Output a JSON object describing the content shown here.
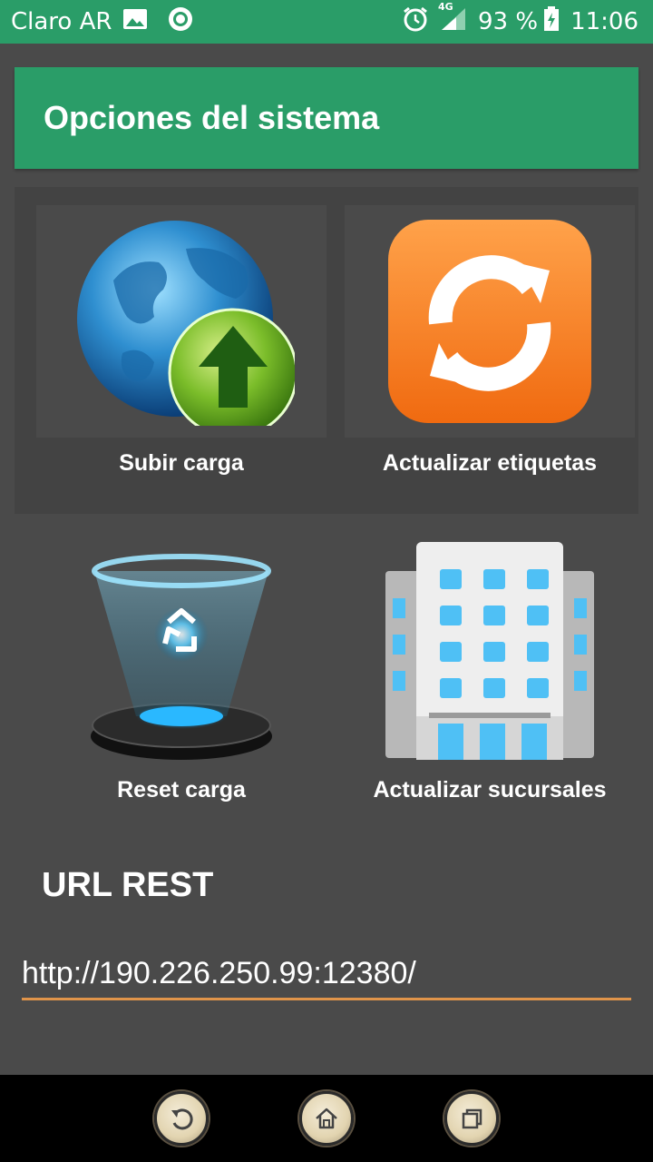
{
  "status_bar": {
    "carrier": "Claro AR",
    "network": "4G",
    "battery": "93 %",
    "time": "11:06",
    "icons": [
      "image-icon",
      "record-icon",
      "alarm-icon",
      "signal-icon",
      "battery-charging-icon"
    ]
  },
  "header": {
    "title": "Opciones del sistema"
  },
  "tiles": [
    {
      "label": "Subir carga",
      "icon": "globe-upload-icon"
    },
    {
      "label": "Actualizar etiquetas",
      "icon": "refresh-icon"
    },
    {
      "label": "Reset carga",
      "icon": "recycle-bin-icon"
    },
    {
      "label": "Actualizar sucursales",
      "icon": "building-icon"
    }
  ],
  "url_section": {
    "title": "URL REST",
    "value": "http://190.226.250.99:12380/"
  },
  "nav_bar": {
    "buttons": [
      "back-button",
      "home-button",
      "recents-button"
    ]
  },
  "colors": {
    "primary": "#2a9d68",
    "background": "#4a4a4a",
    "panel": "#434343",
    "accent_underline": "#e0944a"
  }
}
